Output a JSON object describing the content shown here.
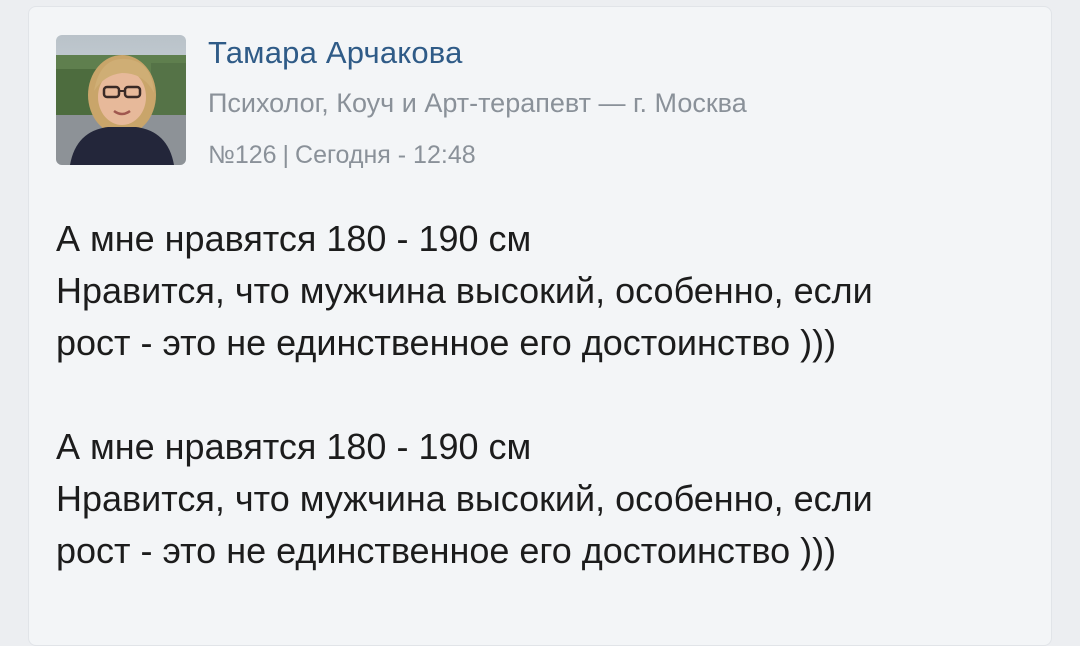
{
  "post": {
    "author": {
      "name": "Тамара Арчакова",
      "description": "Психолог, Коуч и Арт-терапевт — г. Москва"
    },
    "meta": {
      "number": "№126",
      "separator": "|",
      "time": "Сегодня - 12:48"
    },
    "paragraphs": [
      {
        "lines": [
          "А мне нравятся 180 - 190 см",
          "Нравится, что мужчина высокий, особенно, если",
          "рост - это не единственное его достоинство )))"
        ]
      },
      {
        "lines": [
          "А мне нравятся 180 - 190 см",
          "Нравится, что мужчина высокий, особенно, если",
          "рост - это не единственное его достоинство )))"
        ]
      }
    ]
  },
  "colors": {
    "author_name": "#2f5b87",
    "secondary_text": "#8a9199",
    "body_text": "#1c1c1c",
    "card_background": "#f3f5f7"
  }
}
